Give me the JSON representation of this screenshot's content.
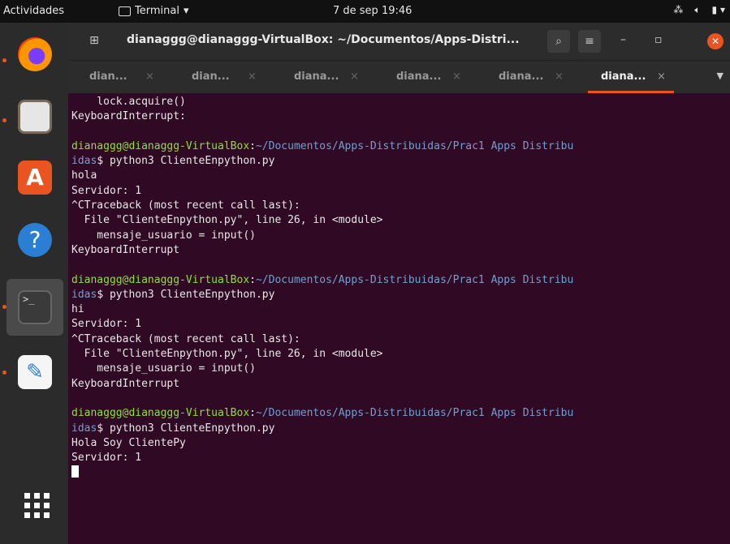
{
  "topbar": {
    "activities": "Actividades",
    "app": "Terminal",
    "clock": "7 de sep  19:46"
  },
  "window": {
    "title": "dianaggg@dianaggg-VirtualBox: ~/Documentos/Apps-Distri...",
    "tabs": [
      {
        "label": "dian...",
        "close": "×"
      },
      {
        "label": "dian...",
        "close": "×"
      },
      {
        "label": "diana...",
        "close": "×"
      },
      {
        "label": "diana...",
        "close": "×"
      },
      {
        "label": "diana...",
        "close": "×"
      },
      {
        "label": "diana...",
        "close": "×"
      }
    ]
  },
  "terminal": {
    "prompt_user": "dianaggg@dianaggg-VirtualBox",
    "prompt_path": "~/Documentos/Apps-Distribuidas/Prac1 Apps Distribu",
    "prompt_path_cont": "idas",
    "lines": [
      {
        "kind": "out",
        "text": "    lock.acquire()"
      },
      {
        "kind": "out",
        "text": "KeyboardInterrupt:"
      },
      {
        "kind": "out",
        "text": ""
      },
      {
        "kind": "prompt"
      },
      {
        "kind": "cmd",
        "text": "$ python3 ClienteEnpython.py"
      },
      {
        "kind": "out",
        "text": "hola"
      },
      {
        "kind": "out",
        "text": "Servidor: 1"
      },
      {
        "kind": "out",
        "text": "^CTraceback (most recent call last):"
      },
      {
        "kind": "out",
        "text": "  File \"ClienteEnpython.py\", line 26, in <module>"
      },
      {
        "kind": "out",
        "text": "    mensaje_usuario = input()"
      },
      {
        "kind": "out",
        "text": "KeyboardInterrupt"
      },
      {
        "kind": "out",
        "text": ""
      },
      {
        "kind": "prompt"
      },
      {
        "kind": "cmd",
        "text": "$ python3 ClienteEnpython.py"
      },
      {
        "kind": "out",
        "text": "hi"
      },
      {
        "kind": "out",
        "text": "Servidor: 1"
      },
      {
        "kind": "out",
        "text": "^CTraceback (most recent call last):"
      },
      {
        "kind": "out",
        "text": "  File \"ClienteEnpython.py\", line 26, in <module>"
      },
      {
        "kind": "out",
        "text": "    mensaje_usuario = input()"
      },
      {
        "kind": "out",
        "text": "KeyboardInterrupt"
      },
      {
        "kind": "out",
        "text": ""
      },
      {
        "kind": "prompt"
      },
      {
        "kind": "cmd",
        "text": "$ python3 ClienteEnpython.py"
      },
      {
        "kind": "out",
        "text": "Hola Soy ClientePy"
      },
      {
        "kind": "out",
        "text": "Servidor: 1"
      },
      {
        "kind": "cursor"
      }
    ]
  },
  "dock": {
    "icons": [
      "firefox-icon",
      "files-icon",
      "software-icon",
      "help-icon",
      "terminal-icon",
      "text-editor-icon",
      "app-grid-icon"
    ]
  },
  "colors": {
    "terminal_bg": "#300a24",
    "prompt_user": "#8ae234",
    "prompt_path": "#729fcf",
    "accent": "#e95420"
  }
}
